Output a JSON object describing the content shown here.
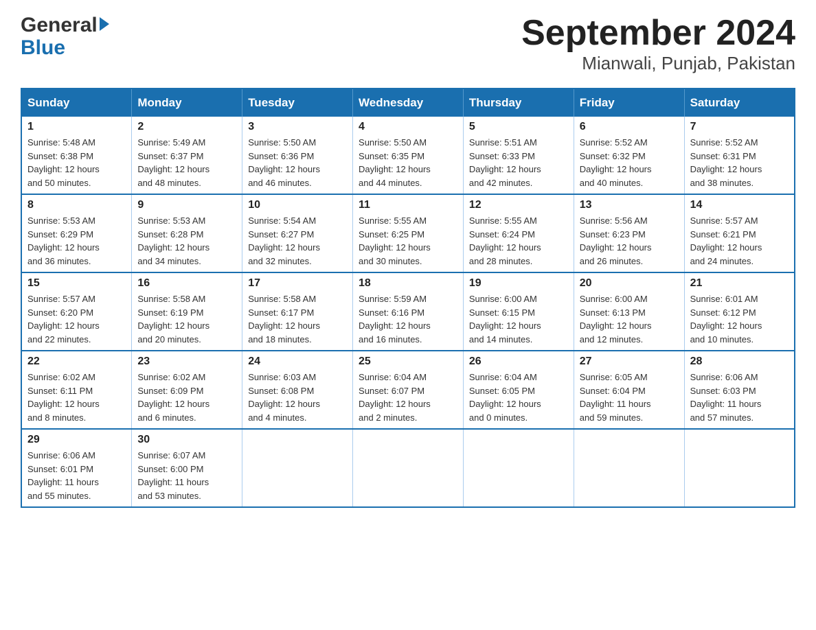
{
  "header": {
    "title": "September 2024",
    "subtitle": "Mianwali, Punjab, Pakistan",
    "logo_general": "General",
    "logo_blue": "Blue"
  },
  "weekdays": [
    "Sunday",
    "Monday",
    "Tuesday",
    "Wednesday",
    "Thursday",
    "Friday",
    "Saturday"
  ],
  "weeks": [
    [
      {
        "day": "1",
        "sunrise": "5:48 AM",
        "sunset": "6:38 PM",
        "daylight": "12 hours and 50 minutes."
      },
      {
        "day": "2",
        "sunrise": "5:49 AM",
        "sunset": "6:37 PM",
        "daylight": "12 hours and 48 minutes."
      },
      {
        "day": "3",
        "sunrise": "5:50 AM",
        "sunset": "6:36 PM",
        "daylight": "12 hours and 46 minutes."
      },
      {
        "day": "4",
        "sunrise": "5:50 AM",
        "sunset": "6:35 PM",
        "daylight": "12 hours and 44 minutes."
      },
      {
        "day": "5",
        "sunrise": "5:51 AM",
        "sunset": "6:33 PM",
        "daylight": "12 hours and 42 minutes."
      },
      {
        "day": "6",
        "sunrise": "5:52 AM",
        "sunset": "6:32 PM",
        "daylight": "12 hours and 40 minutes."
      },
      {
        "day": "7",
        "sunrise": "5:52 AM",
        "sunset": "6:31 PM",
        "daylight": "12 hours and 38 minutes."
      }
    ],
    [
      {
        "day": "8",
        "sunrise": "5:53 AM",
        "sunset": "6:29 PM",
        "daylight": "12 hours and 36 minutes."
      },
      {
        "day": "9",
        "sunrise": "5:53 AM",
        "sunset": "6:28 PM",
        "daylight": "12 hours and 34 minutes."
      },
      {
        "day": "10",
        "sunrise": "5:54 AM",
        "sunset": "6:27 PM",
        "daylight": "12 hours and 32 minutes."
      },
      {
        "day": "11",
        "sunrise": "5:55 AM",
        "sunset": "6:25 PM",
        "daylight": "12 hours and 30 minutes."
      },
      {
        "day": "12",
        "sunrise": "5:55 AM",
        "sunset": "6:24 PM",
        "daylight": "12 hours and 28 minutes."
      },
      {
        "day": "13",
        "sunrise": "5:56 AM",
        "sunset": "6:23 PM",
        "daylight": "12 hours and 26 minutes."
      },
      {
        "day": "14",
        "sunrise": "5:57 AM",
        "sunset": "6:21 PM",
        "daylight": "12 hours and 24 minutes."
      }
    ],
    [
      {
        "day": "15",
        "sunrise": "5:57 AM",
        "sunset": "6:20 PM",
        "daylight": "12 hours and 22 minutes."
      },
      {
        "day": "16",
        "sunrise": "5:58 AM",
        "sunset": "6:19 PM",
        "daylight": "12 hours and 20 minutes."
      },
      {
        "day": "17",
        "sunrise": "5:58 AM",
        "sunset": "6:17 PM",
        "daylight": "12 hours and 18 minutes."
      },
      {
        "day": "18",
        "sunrise": "5:59 AM",
        "sunset": "6:16 PM",
        "daylight": "12 hours and 16 minutes."
      },
      {
        "day": "19",
        "sunrise": "6:00 AM",
        "sunset": "6:15 PM",
        "daylight": "12 hours and 14 minutes."
      },
      {
        "day": "20",
        "sunrise": "6:00 AM",
        "sunset": "6:13 PM",
        "daylight": "12 hours and 12 minutes."
      },
      {
        "day": "21",
        "sunrise": "6:01 AM",
        "sunset": "6:12 PM",
        "daylight": "12 hours and 10 minutes."
      }
    ],
    [
      {
        "day": "22",
        "sunrise": "6:02 AM",
        "sunset": "6:11 PM",
        "daylight": "12 hours and 8 minutes."
      },
      {
        "day": "23",
        "sunrise": "6:02 AM",
        "sunset": "6:09 PM",
        "daylight": "12 hours and 6 minutes."
      },
      {
        "day": "24",
        "sunrise": "6:03 AM",
        "sunset": "6:08 PM",
        "daylight": "12 hours and 4 minutes."
      },
      {
        "day": "25",
        "sunrise": "6:04 AM",
        "sunset": "6:07 PM",
        "daylight": "12 hours and 2 minutes."
      },
      {
        "day": "26",
        "sunrise": "6:04 AM",
        "sunset": "6:05 PM",
        "daylight": "12 hours and 0 minutes."
      },
      {
        "day": "27",
        "sunrise": "6:05 AM",
        "sunset": "6:04 PM",
        "daylight": "11 hours and 59 minutes."
      },
      {
        "day": "28",
        "sunrise": "6:06 AM",
        "sunset": "6:03 PM",
        "daylight": "11 hours and 57 minutes."
      }
    ],
    [
      {
        "day": "29",
        "sunrise": "6:06 AM",
        "sunset": "6:01 PM",
        "daylight": "11 hours and 55 minutes."
      },
      {
        "day": "30",
        "sunrise": "6:07 AM",
        "sunset": "6:00 PM",
        "daylight": "11 hours and 53 minutes."
      },
      null,
      null,
      null,
      null,
      null
    ]
  ],
  "labels": {
    "sunrise": "Sunrise:",
    "sunset": "Sunset:",
    "daylight": "Daylight:"
  }
}
